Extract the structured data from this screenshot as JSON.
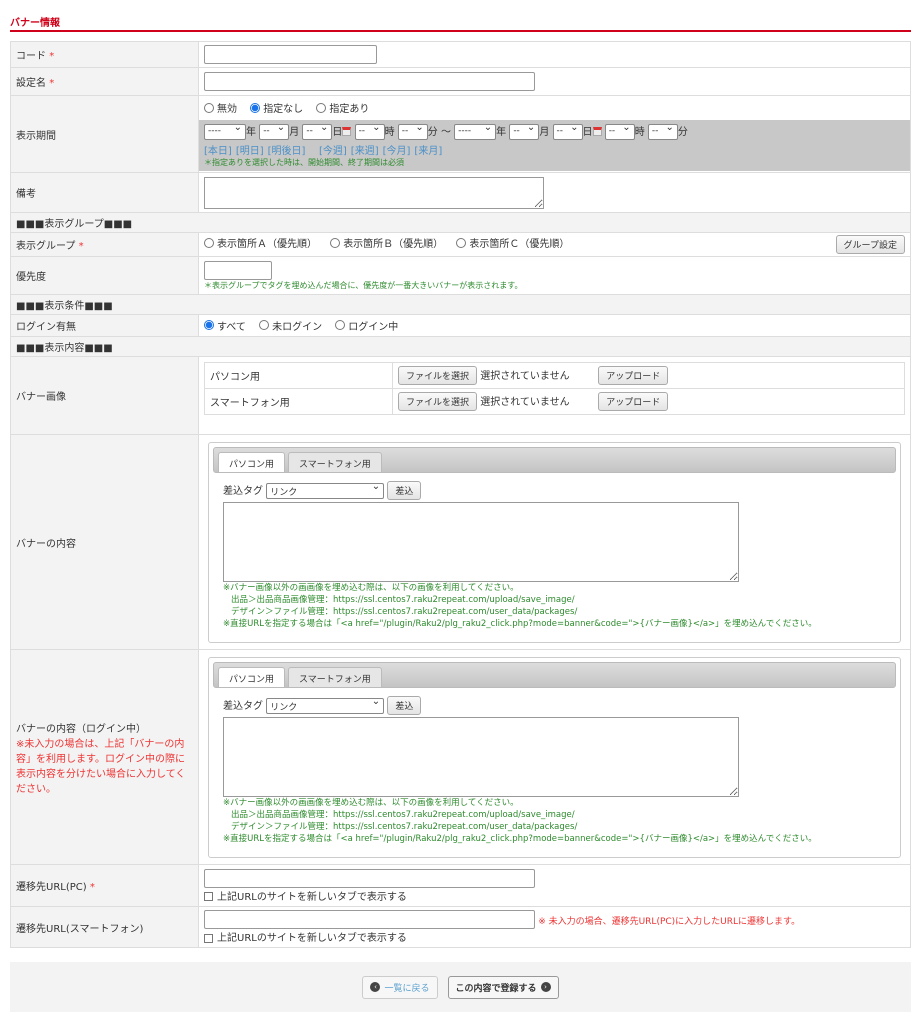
{
  "title": "バナー情報",
  "req": "*",
  "code": {
    "label": "コード"
  },
  "name": {
    "label": "設定名"
  },
  "period": {
    "label": "表示期間",
    "radios": [
      "無効",
      "指定なし",
      "指定あり"
    ],
    "year": "----",
    "dash": "--",
    "y": "年",
    "m": "月",
    "d": "日",
    "h": "時",
    "mi": "分",
    "tilde": "～",
    "links1": [
      "[本日]",
      "[明日]",
      "[明後日]"
    ],
    "links2": [
      "[今週]",
      "[来週]",
      "[今月]",
      "[来月]"
    ],
    "note": "＊指定ありを選択した時は、開始期間、終了期間は必須"
  },
  "memo": {
    "label": "備考"
  },
  "sec_group": "■■■表示グループ■■■",
  "group": {
    "label": "表示グループ",
    "radios": [
      "表示箇所Ａ（優先順）",
      "表示箇所Ｂ（優先順）",
      "表示箇所Ｃ（優先順）"
    ],
    "button": "グループ設定"
  },
  "priority": {
    "label": "優先度",
    "note": "＊表示グループでタグを埋め込んだ場合に、優先度が一番大きいバナーが表示されます。"
  },
  "sec_cond": "■■■表示条件■■■",
  "login": {
    "label": "ログイン有無",
    "radios": [
      "すべて",
      "未ログイン",
      "ログイン中"
    ]
  },
  "sec_content": "■■■表示内容■■■",
  "image": {
    "label": "バナー画像",
    "rows": [
      {
        "name": "パソコン用"
      },
      {
        "name": "スマートフォン用"
      }
    ],
    "file_button": "ファイルを選択",
    "no_file": "選択されていません",
    "upload": "アップロード"
  },
  "content": {
    "label": "バナーの内容",
    "label_login": "バナーの内容（ログイン中）",
    "login_note": "※未入力の場合は、上記「バナーの内容」を利用します。ログイン中の際に表示内容を分けたい場合に入力してください。",
    "tabs": [
      "パソコン用",
      "スマートフォン用"
    ],
    "tag_label": "差込タグ",
    "tag_value": "リンク",
    "insert": "差込",
    "notes": [
      "※バナー画像以外の画画像を埋め込む際は、以下の画像を利用してください。",
      "出品＞出品商品画像管理：https://ssl.centos7.raku2repeat.com/upload/save_image/",
      "デザイン＞ファイル管理：https://ssl.centos7.raku2repeat.com/user_data/packages/",
      "※直接URLを指定する場合は「<a href=\"/plugin/Raku2/plg_raku2_click.php?mode=banner&code=\">{バナー画像}</a>」を埋め込んでください。"
    ]
  },
  "url_pc": {
    "label": "遷移先URL(PC)",
    "newtab": "上記URLのサイトを新しいタブで表示する"
  },
  "url_sp": {
    "label": "遷移先URL(スマートフォン)",
    "note": "※ 未入力の場合、遷移先URL(PC)に入力したURLに遷移します。",
    "newtab": "上記URLのサイトを新しいタブで表示する"
  },
  "footer": {
    "back": "一覧に戻る",
    "submit": "この内容で登録する"
  }
}
